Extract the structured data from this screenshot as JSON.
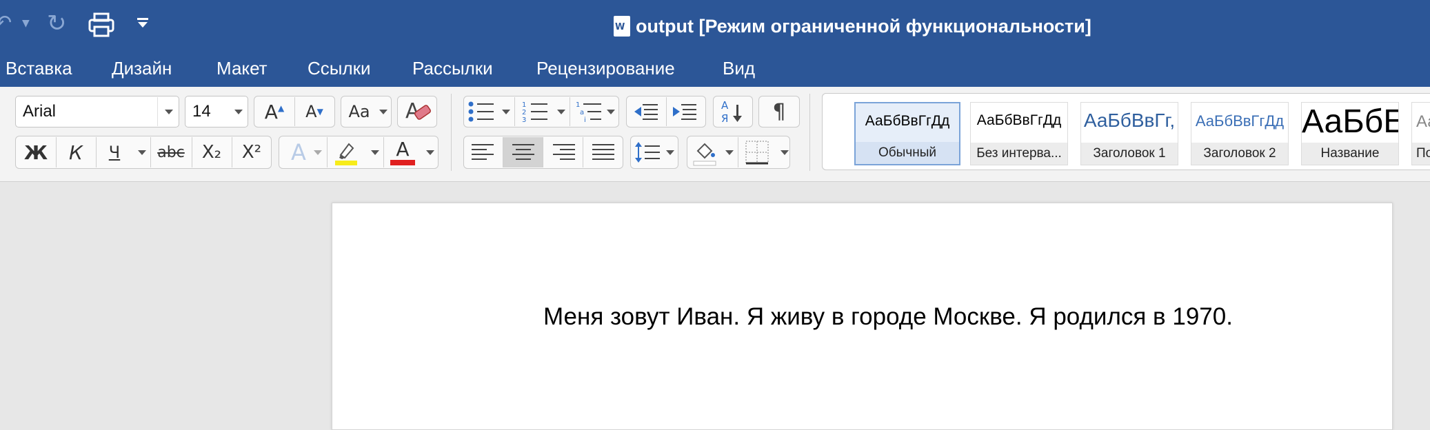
{
  "window": {
    "title": "output [Режим ограниченной функциональности]"
  },
  "quick_access": {
    "icons": [
      "undo-icon",
      "redo-icon",
      "print-icon",
      "customize-icon"
    ]
  },
  "menu_tabs": [
    "Вставка",
    "Дизайн",
    "Макет",
    "Ссылки",
    "Рассылки",
    "Рецензирование",
    "Вид"
  ],
  "font": {
    "family": "Arial",
    "size": "14"
  },
  "format_buttons": {
    "bold": "Ж",
    "italic": "К",
    "underline": "Ч",
    "strike": "abc",
    "subscript": "X₂",
    "superscript": "X²",
    "font_color_letter": "A",
    "grow": "A",
    "shrink": "A",
    "case": "Aa"
  },
  "styles": [
    {
      "sample": "АаБбВвГгДд",
      "label": "Обычный",
      "selected": true
    },
    {
      "sample": "АаБбВвГгДд",
      "label": "Без интерва..."
    },
    {
      "sample": "АаБбВвГг,",
      "label": "Заголовок 1"
    },
    {
      "sample": "АаБбВвГгДд",
      "label": "Заголовок 2"
    },
    {
      "sample": "АаБбЕ",
      "label": "Название"
    },
    {
      "sample": "Аа",
      "label": "По"
    }
  ],
  "colors": {
    "highlight": "#f7ec1a",
    "font_color": "#e02020",
    "title_bar": "#2c5697"
  },
  "document": {
    "text": "Меня зовут Иван. Я живу в городе Москве. Я родился в 1970."
  }
}
